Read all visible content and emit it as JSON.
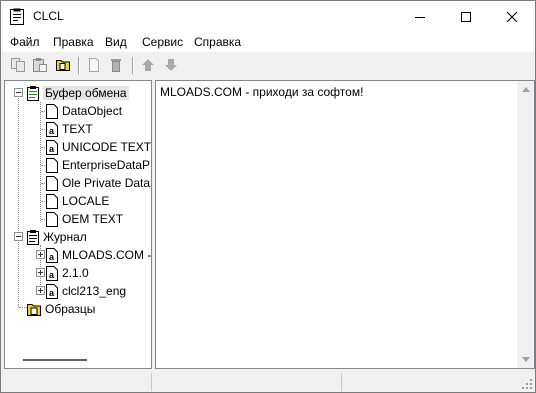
{
  "window": {
    "title": "CLCL",
    "app_icon": "clipboard-icon",
    "controls": [
      "minimize-icon",
      "maximize-icon",
      "close-icon"
    ]
  },
  "menu": {
    "items": [
      "Файл",
      "Правка",
      "Вид",
      "Сервис",
      "Справка"
    ]
  },
  "toolbar": {
    "buttons": [
      "copy-icon",
      "paste-icon",
      "folder-icon",
      "new-item-icon",
      "delete-icon",
      "move-up-icon",
      "move-down-icon"
    ]
  },
  "tree": {
    "clipboard": {
      "label": "Буфер обмена",
      "children": [
        "DataObject",
        "TEXT",
        "UNICODE TEXT",
        "EnterpriseDataP",
        "Ole Private Data",
        "LOCALE",
        "OEM TEXT"
      ]
    },
    "history": {
      "label": "Журнал",
      "children": [
        "MLOADS.COM -",
        "2.1.0",
        "clcl213_eng"
      ]
    },
    "templates": {
      "label": "Образцы"
    }
  },
  "viewer": {
    "text": "MLOADS.COM - приходи за софтом!"
  },
  "colors": {
    "tree_line": "#8c8c8c",
    "folder_yellow": "#f2d22e",
    "border": "#828790"
  }
}
